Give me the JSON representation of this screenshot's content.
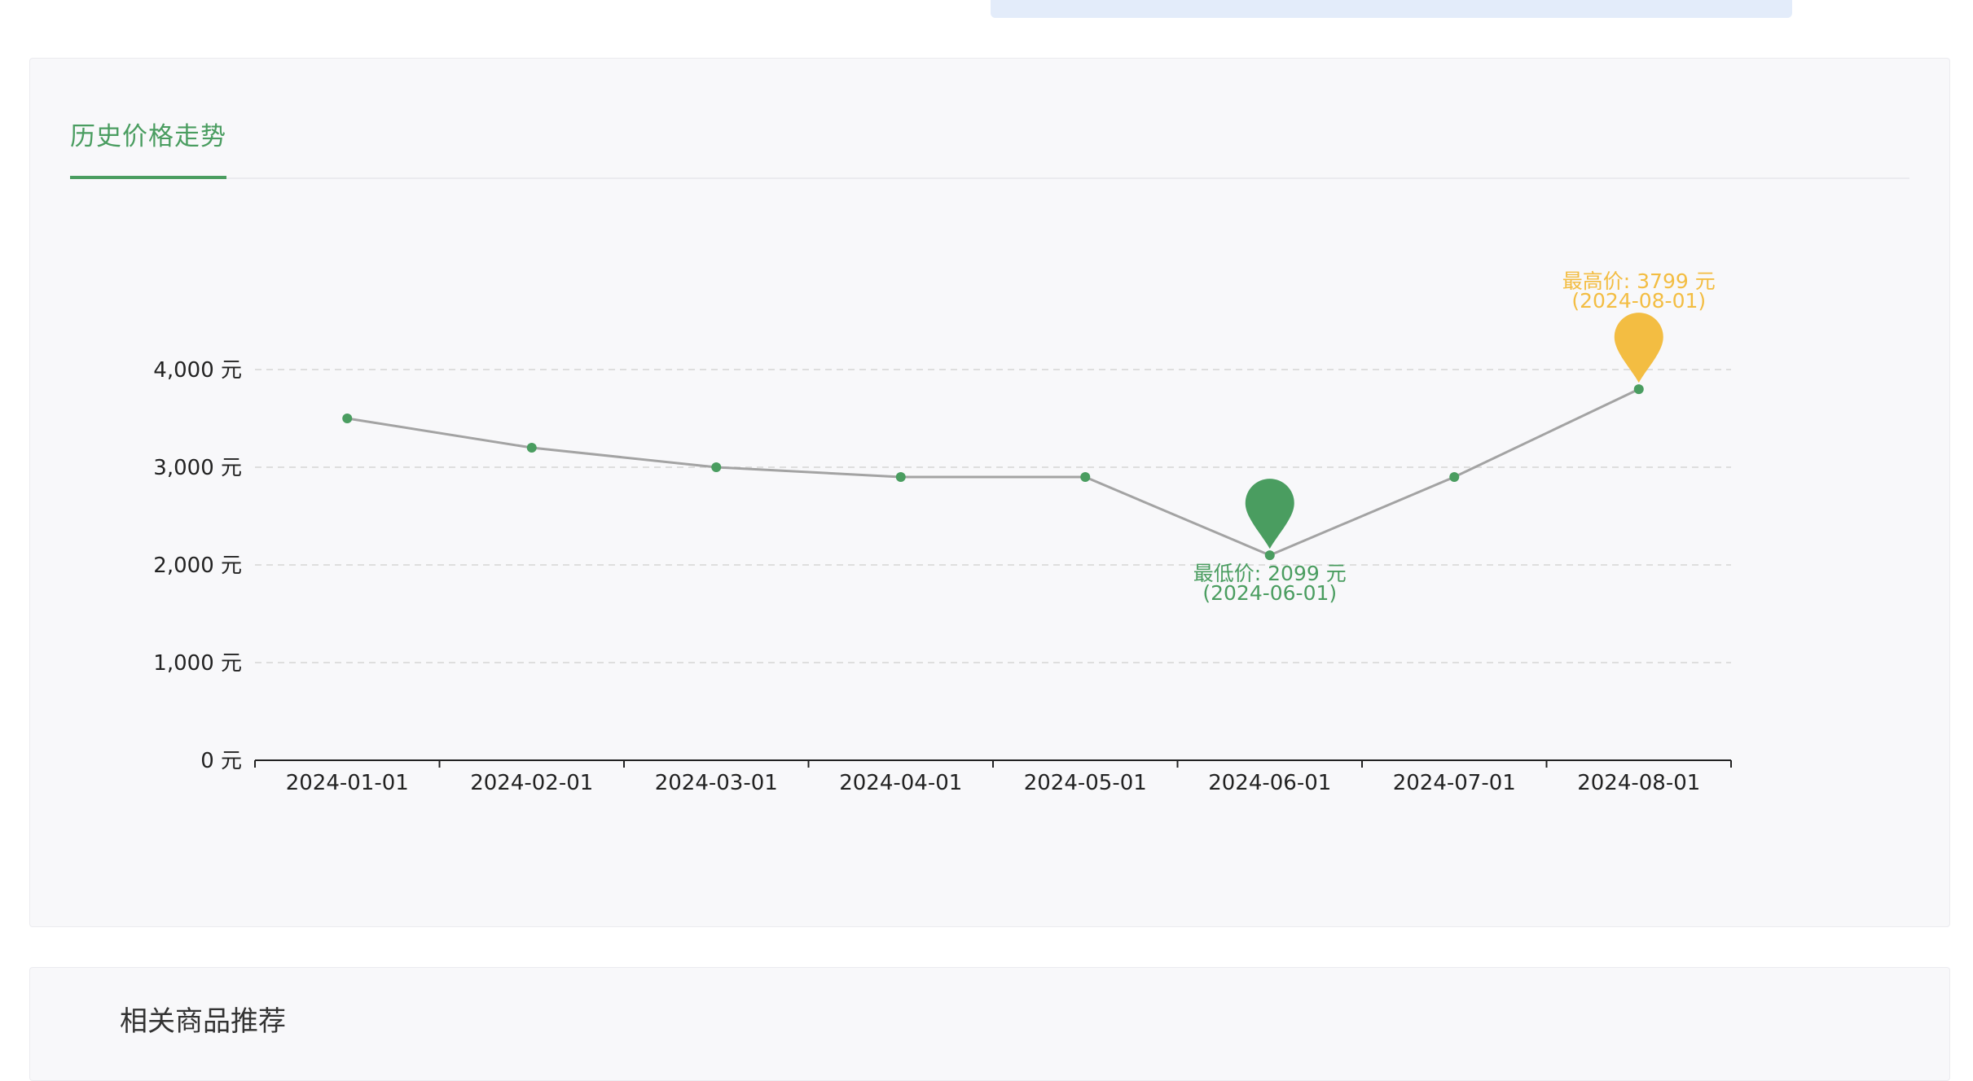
{
  "page": {
    "banner_text": "",
    "price_section": {
      "tab_label": "历史价格走势"
    },
    "related_section": {
      "title": "相关商品推荐"
    }
  },
  "colors": {
    "line": "#a3a3a3",
    "point": "#4a9d60",
    "min_marker": "#4a9d60",
    "max_marker": "#f3bd42",
    "grid": "#dedede",
    "axis": "#222222"
  },
  "chart_data": {
    "type": "line",
    "title": "",
    "xlabel": "",
    "ylabel": "",
    "x": [
      "2024-01-01",
      "2024-02-01",
      "2024-03-01",
      "2024-04-01",
      "2024-05-01",
      "2024-06-01",
      "2024-07-01",
      "2024-08-01"
    ],
    "series": [
      {
        "values": [
          3500,
          3200,
          3000,
          2900,
          2900,
          2099,
          2900,
          3799
        ]
      }
    ],
    "ylim": [
      0,
      4000
    ],
    "y_ticks": [
      0,
      1000,
      2000,
      3000,
      4000
    ],
    "y_tick_labels": [
      "0 元",
      "1,000 元",
      "2,000 元",
      "3,000 元",
      "4,000 元"
    ],
    "grid": true,
    "annotations": {
      "min": {
        "label": "最低价: 2099 元",
        "date": "(2024-06-01)",
        "index": 5
      },
      "max": {
        "label": "最高价: 3799 元",
        "date": "(2024-08-01)",
        "index": 7
      }
    }
  }
}
